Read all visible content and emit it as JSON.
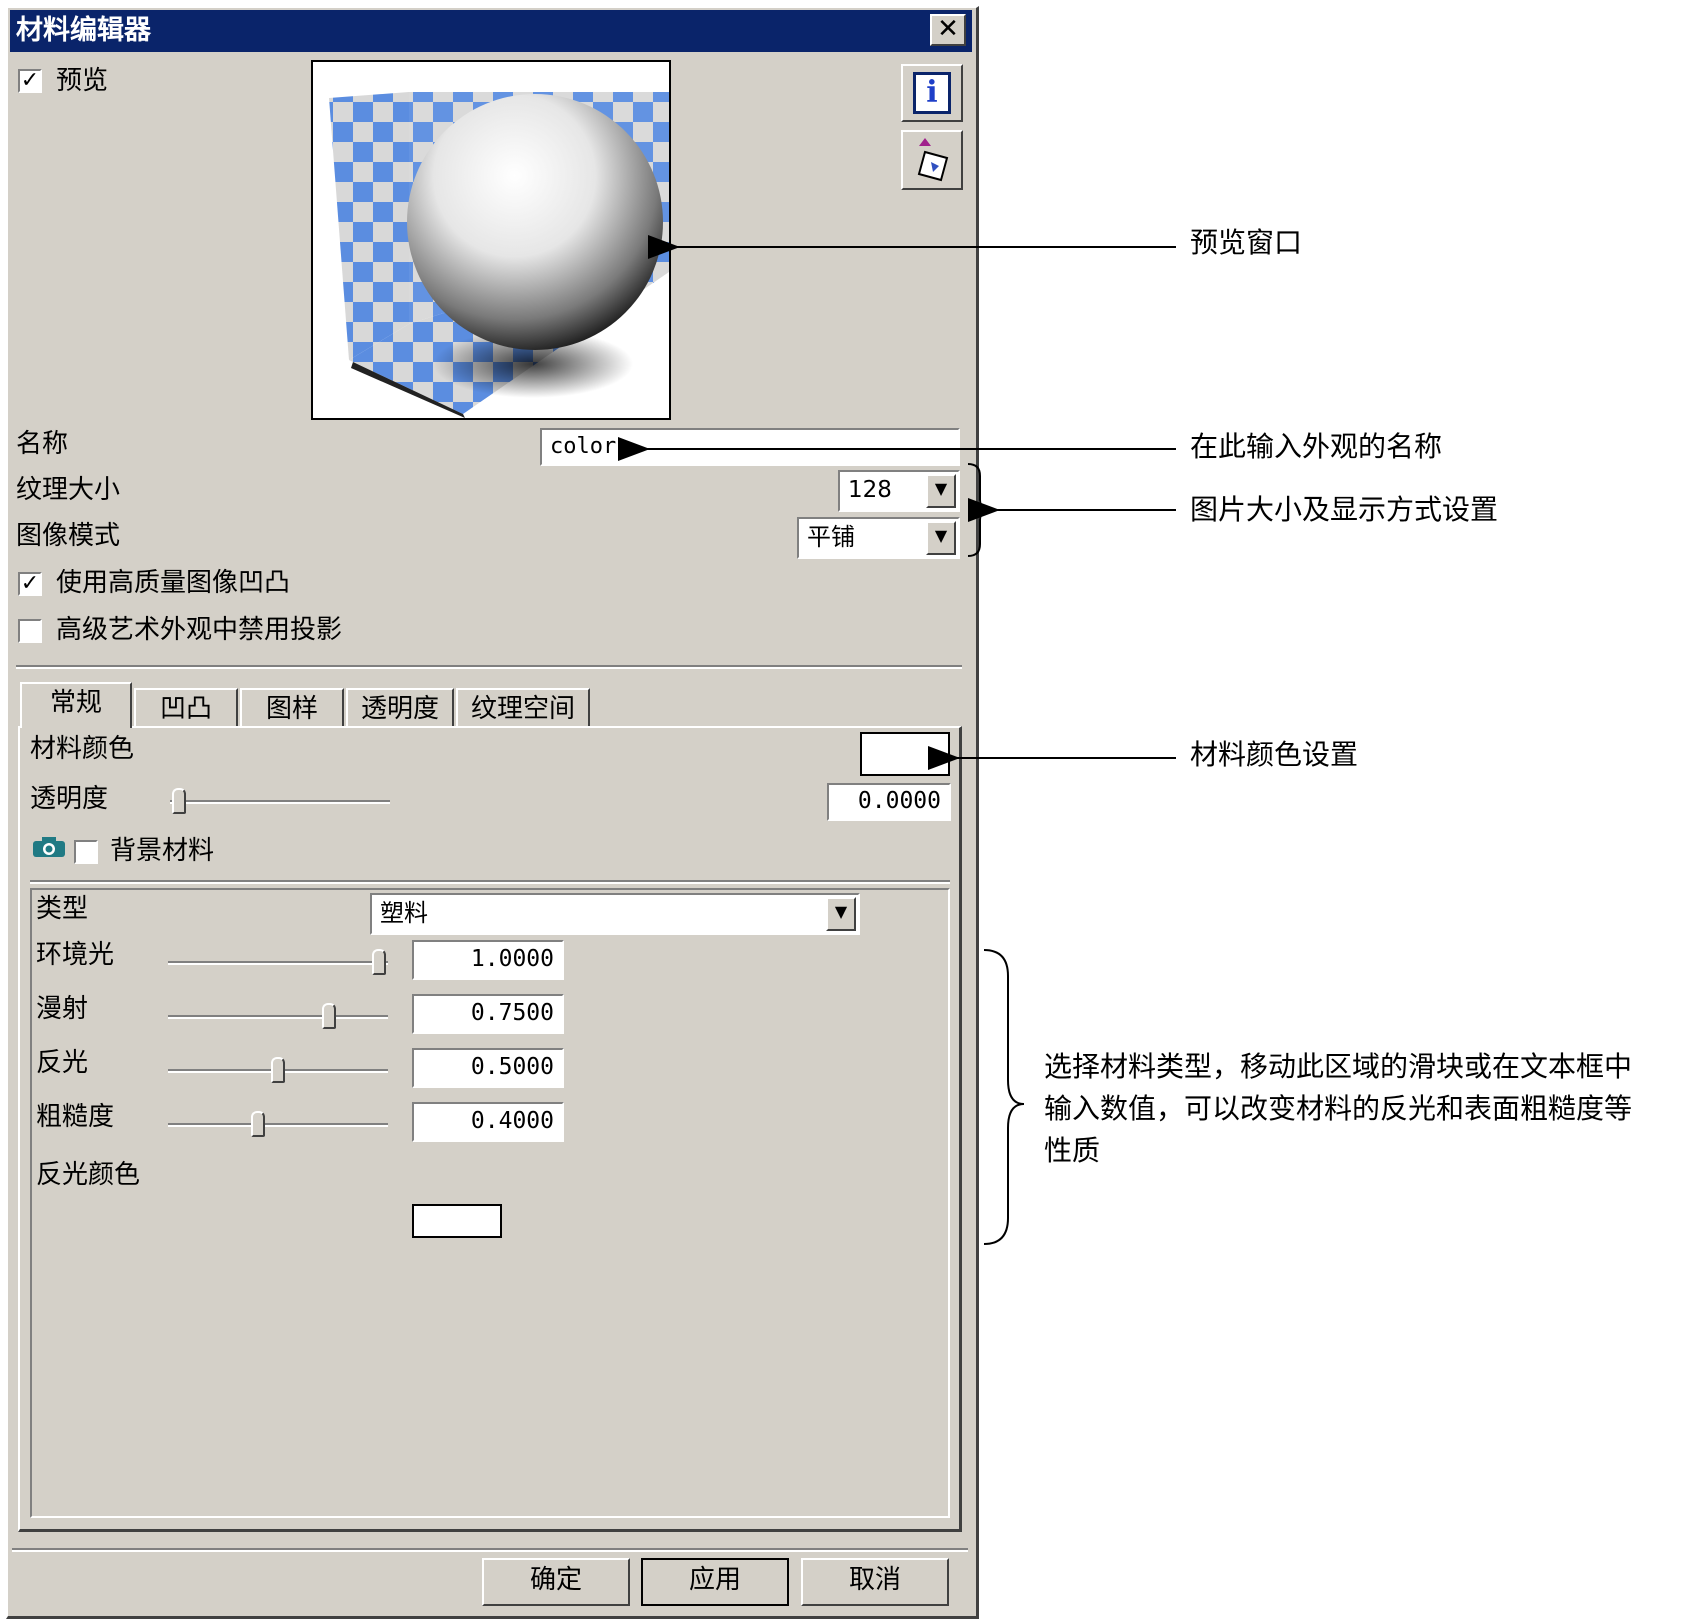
{
  "window": {
    "title": "材料编辑器",
    "close_glyph": "✕"
  },
  "preview": {
    "checkbox_label": "预览",
    "checked": true
  },
  "toolbar": {
    "info_icon": "info-icon",
    "load_icon": "load-material-icon"
  },
  "name": {
    "label": "名称",
    "value": "color"
  },
  "texture_size": {
    "label": "纹理大小",
    "value": "128"
  },
  "image_mode": {
    "label": "图像模式",
    "value": "平铺"
  },
  "options": {
    "high_quality_bump": {
      "label": "使用高质量图像凹凸",
      "checked": true
    },
    "disable_shadow": {
      "label": "高级艺术外观中禁用投影",
      "checked": false
    }
  },
  "tabs": [
    {
      "label": "常规",
      "active": true
    },
    {
      "label": "凹凸",
      "active": false
    },
    {
      "label": "图样",
      "active": false
    },
    {
      "label": "透明度",
      "active": false
    },
    {
      "label": "纹理空间",
      "active": false
    }
  ],
  "general": {
    "material_color_label": "材料颜色",
    "material_color": "#ffffff",
    "transparency_label": "透明度",
    "transparency_value": "0.0000",
    "transparency_fraction": 0.0,
    "background_material_label": "背景材料",
    "background_material_checked": false
  },
  "material": {
    "type_label": "类型",
    "type_value": "塑料",
    "sliders": [
      {
        "label": "环境光",
        "value": "1.0000",
        "fraction": 1.0
      },
      {
        "label": "漫射",
        "value": "0.7500",
        "fraction": 0.75
      },
      {
        "label": "反光",
        "value": "0.5000",
        "fraction": 0.5
      },
      {
        "label": "粗糙度",
        "value": "0.4000",
        "fraction": 0.4
      }
    ],
    "specular_color_label": "反光颜色",
    "specular_color": "#ffffff"
  },
  "buttons": {
    "ok": "确定",
    "apply": "应用",
    "cancel": "取消"
  },
  "annotations": {
    "preview_window": "预览窗口",
    "name_input": "在此输入外观的名称",
    "image_settings": "图片大小及显示方式设置",
    "material_color": "材料颜色设置",
    "material_type_line1": "选择材料类型，移动此区域的滑块或在文本框中",
    "material_type_line2": "输入数值，可以改变材料的反光和表面粗糙度等",
    "material_type_line3": "性质"
  },
  "colors": {
    "dialog_bg": "#d4d0c8",
    "titlebar": "#0a246a",
    "checker_blue": "#5b8de0"
  }
}
